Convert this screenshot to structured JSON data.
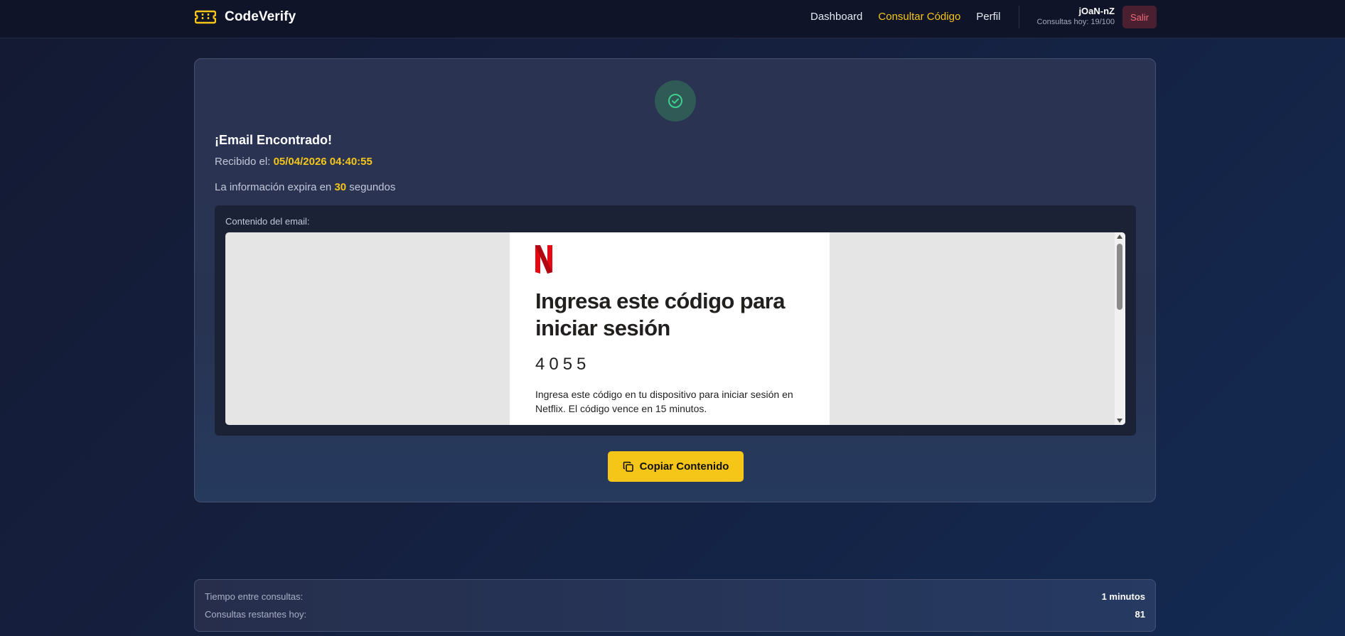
{
  "header": {
    "brand_name": "CodeVerify",
    "nav": [
      "Dashboard",
      "Consultar Código",
      "Perfil"
    ],
    "active_nav": "Consultar Código",
    "username": "jOaN-nZ",
    "quota_text": "Consultas hoy: 19/100",
    "logout_label": "Salir"
  },
  "result": {
    "title": "¡Email Encontrado!",
    "received_prefix": "Recibido el:",
    "received_at": "05/04/2026 04:40:55",
    "expire_prefix": "La información expira en",
    "expire_seconds": "30",
    "expire_suffix": "segundos",
    "content_label": "Contenido del email:",
    "copy_button": "Copiar Contenido"
  },
  "email": {
    "heading": "Ingresa este código para iniciar sesión",
    "code": "4055",
    "body": "Ingresa este código en tu dispositivo para iniciar sesión en Netflix. El código vence en 15 minutos."
  },
  "info": {
    "interval_label": "Tiempo entre consultas:",
    "interval_value": "1 minutos",
    "remaining_label": "Consultas restantes hoy:",
    "remaining_value": "81"
  },
  "colors": {
    "accent": "#f5c518",
    "success": "#3ecf8e",
    "netflix_red": "#e50914",
    "danger_text": "#f06a7b"
  },
  "icons": {
    "brand": "ticket-icon",
    "success": "check-circle-icon",
    "copy": "copy-icon",
    "email_logo": "netflix-logo"
  }
}
